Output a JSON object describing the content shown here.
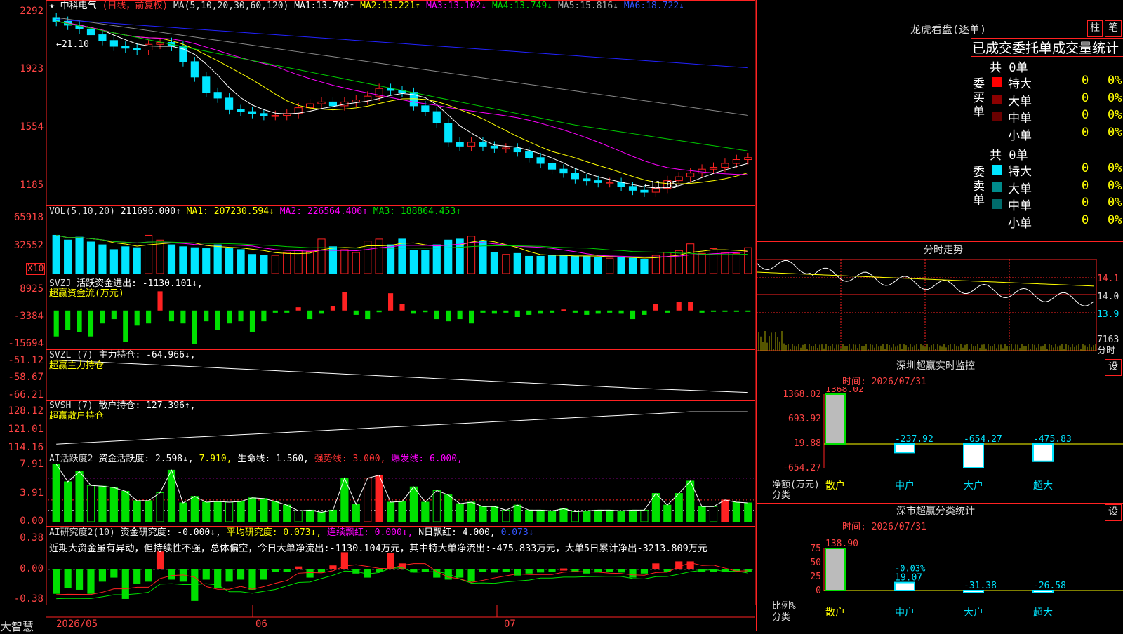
{
  "colors": {
    "up": "#ff2222",
    "down": "#00e5ff",
    "green": "#00e000",
    "grid": "#ff2222",
    "ma1": "#ffffff",
    "ma2": "#ffff00",
    "ma3": "#ff00ff",
    "ma4": "#00cc00",
    "ma5": "#888888",
    "ma6": "#2222ff"
  },
  "header": {
    "star": "★",
    "name": "中科电气",
    "period": "(日线，前复权)",
    "ma_label": "MA(5,10,20,30,60,120)",
    "ma": [
      {
        "label": "MA1:",
        "value": "13.702↑"
      },
      {
        "label": "MA2:",
        "value": "13.221↑"
      },
      {
        "label": "MA3:",
        "value": "13.102↓"
      },
      {
        "label": "MA4:",
        "value": "13.749↓"
      },
      {
        "label": "MA5:",
        "value": "15.816↓"
      },
      {
        "label": "MA6:",
        "value": "18.722↓"
      }
    ]
  },
  "price_axis": [
    "2292",
    "1923",
    "1554",
    "1185"
  ],
  "price_notes": {
    "high": "←21.10",
    "low": "←11.85"
  },
  "vol": {
    "label": "VOL(5,10,20)",
    "value": "211696.000↑",
    "ma1": "MA1: 207230.594↓",
    "ma2": "MA2: 226564.406↑",
    "ma3": "MA3: 188864.453↑",
    "axis": [
      "65918",
      "32552"
    ],
    "unit": "X10"
  },
  "svzj": {
    "label": "SVZJ",
    "name": "活跃资金进出: -1130.101↓,",
    "sub": "超赢资金流(万元)",
    "axis": [
      "8925",
      "-3384",
      "-15694"
    ]
  },
  "svzl": {
    "label": "SVZL (7)",
    "name": "主力持仓: -64.966↓,",
    "sub": "超赢主力持仓",
    "axis": [
      "-51.12",
      "-58.67",
      "-66.21"
    ]
  },
  "svsh": {
    "label": "SVSH (7)",
    "name": "散户持仓: 127.396↑,",
    "sub": "超赢散户持仓",
    "axis": [
      "128.12",
      "121.01",
      "114.16"
    ]
  },
  "ai1": {
    "label": "AI活跃度2",
    "p1": "资金活跃度: 2.598↓,",
    "p2": "7.910,",
    "p3": "生命线: 1.560,",
    "p4": "强势线: 3.000,",
    "p5": "爆发线: 6.000,",
    "axis": [
      "7.91",
      "3.91",
      "0.00"
    ]
  },
  "ai2": {
    "label": "AI研究度2(10)",
    "p1": "资金研究度: -0.000↓,",
    "p2": "平均研究度: 0.073↓,",
    "p3": "连续飘红: 0.000↓,",
    "p4": "N日飘红: 4.000,",
    "p5": "0.073↓",
    "comment": "近期大资金虽有异动，但持续性不强，总体偏空，今日大单净流出:-1130.104万元，其中特大单净流出:-475.833万元，大单5日累计净出-3213.809万元",
    "axis": [
      "0.38",
      "0.00",
      "-0.38"
    ]
  },
  "bottom": {
    "logo": "大智慧",
    "dates": [
      "2026/05",
      "06",
      "07"
    ]
  },
  "right": {
    "title": "龙虎看盘(逐单)",
    "btn1": "柱",
    "btn2": "笔",
    "table_title": "已成交委托单成交量统计",
    "buy": {
      "label": "委买单",
      "total": "共 0单",
      "rows": [
        {
          "name": "特大",
          "count": "0",
          "pct": "0%"
        },
        {
          "name": "大单",
          "count": "0",
          "pct": "0%"
        },
        {
          "name": "中单",
          "count": "0",
          "pct": "0%"
        },
        {
          "name": "小单",
          "count": "0",
          "pct": "0%"
        }
      ]
    },
    "sell": {
      "label": "委卖单",
      "total": "共 0单",
      "rows": [
        {
          "name": "特大",
          "count": "0",
          "pct": "0%"
        },
        {
          "name": "大单",
          "count": "0",
          "pct": "0%"
        },
        {
          "name": "中单",
          "count": "0",
          "pct": "0%"
        },
        {
          "name": "小单",
          "count": "0",
          "pct": "0%"
        }
      ]
    },
    "intraday": {
      "title": "分时走势",
      "axis": [
        "14.1",
        "14.0",
        "13.9"
      ],
      "vol": "7163",
      "vol_unit": "分时"
    },
    "monitor": {
      "title": "深圳超赢实时监控",
      "setbtn": "设",
      "time": "时间: 2026/07/31",
      "axis": [
        "1368.02",
        "693.92",
        "19.88",
        "-654.27"
      ],
      "ylabel": "净额(万元)",
      "xlabel": "分类",
      "bars": [
        {
          "cat": "散户",
          "value": 1368.02,
          "label": "1368.02"
        },
        {
          "cat": "中户",
          "value": -237.92,
          "label": "-237.92"
        },
        {
          "cat": "大户",
          "value": -654.27,
          "label": "-654.27"
        },
        {
          "cat": "超大",
          "value": -475.83,
          "label": "-475.83"
        }
      ]
    },
    "stats": {
      "title": "深市超赢分类统计",
      "setbtn": "设",
      "time": "时间: 2026/07/31",
      "axis": [
        "75",
        "50",
        "25",
        "0"
      ],
      "ylabel": "比例%",
      "xlabel": "分类",
      "bars": [
        {
          "cat": "散户",
          "value": 138.9,
          "label": "138.90"
        },
        {
          "cat": "中户",
          "value": 19.07,
          "label": "19.07",
          "extra": "-0.03%"
        },
        {
          "cat": "大户",
          "value": -31.38,
          "label": "-31.38"
        },
        {
          "cat": "超大",
          "value": -26.58,
          "label": "-26.58"
        }
      ]
    }
  },
  "chart_data": {
    "type": "candlestick",
    "series": [
      {
        "name": "price_close",
        "values": [
          20.9,
          20.7,
          20.5,
          20.2,
          19.9,
          19.6,
          19.5,
          19.4,
          19.7,
          19.8,
          19.6,
          18.8,
          18.0,
          17.2,
          16.9,
          16.3,
          16.2,
          16.1,
          16.0,
          16.0,
          16.1,
          16.4,
          16.6,
          16.7,
          16.5,
          16.7,
          16.8,
          17.0,
          17.4,
          17.3,
          17.2,
          16.5,
          16.2,
          15.6,
          14.6,
          14.4,
          14.6,
          14.4,
          14.3,
          14.3,
          14.1,
          13.8,
          13.5,
          13.2,
          13.0,
          12.7,
          12.6,
          12.5,
          12.5,
          12.3,
          12.1,
          12.0,
          12.2,
          12.6,
          12.8,
          13.0,
          13.2,
          13.3,
          13.5,
          13.7,
          13.8
        ]
      },
      {
        "name": "volume",
        "values": [
          40000,
          35000,
          38000,
          33000,
          30000,
          25000,
          28000,
          27000,
          40000,
          35000,
          30000,
          28000,
          27000,
          26000,
          30000,
          26000,
          25000,
          20000,
          19000,
          19000,
          22000,
          24000,
          23000,
          36000,
          28000,
          25000,
          22000,
          34000,
          36000,
          30000,
          36000,
          24000,
          24000,
          30000,
          35000,
          36000,
          39000,
          34000,
          22000,
          20000,
          21000,
          18000,
          18000,
          19000,
          19000,
          18000,
          18000,
          17000,
          16000,
          17000,
          16000,
          15000,
          19000,
          22000,
          24000,
          31000,
          21000,
          26000,
          22000,
          21000,
          27000
        ]
      },
      {
        "name": "fund_flow",
        "values": [
          -12000,
          -9000,
          -10000,
          -12000,
          -6000,
          -4000,
          -14500,
          -7000,
          -6000,
          8900,
          -5000,
          -6000,
          -15500,
          -5000,
          -9000,
          -6000,
          -5000,
          -10000,
          -5000,
          -1000,
          -1000,
          1500,
          -4000,
          -1500,
          2000,
          8500,
          -2000,
          -4000,
          -800,
          8000,
          3000,
          -1500,
          -800,
          -4000,
          -5000,
          -4000,
          -6000,
          -1000,
          -1500,
          -1000,
          -3000,
          -2000,
          -1500,
          -1000,
          500,
          -1000,
          -2000,
          -1500,
          -1000,
          -1500,
          -4000,
          -2000,
          3000,
          -1000,
          4000,
          4000,
          -1000,
          -500,
          -500,
          -500,
          -500
        ]
      },
      {
        "name": "activity",
        "values": [
          7.91,
          5.5,
          6.9,
          5.0,
          4.9,
          4.7,
          4.2,
          2.9,
          2.9,
          4.0,
          7.1,
          2.6,
          3.5,
          2.7,
          2.8,
          2.7,
          2.8,
          3.3,
          3.2,
          2.8,
          2.3,
          1.5,
          1.6,
          1.3,
          1.6,
          6.0,
          2.4,
          6.0,
          6.4,
          2.7,
          2.8,
          4.8,
          2.7,
          4.3,
          3.7,
          2.5,
          2.7,
          2.1,
          2.1,
          1.6,
          2.3,
          1.6,
          1.6,
          1.5,
          1.8,
          1.4,
          1.5,
          1.6,
          1.6,
          1.5,
          1.6,
          1.6,
          3.9,
          2.3,
          3.9,
          5.6,
          2.1,
          2.1,
          3.0,
          2.7,
          2.6
        ]
      }
    ]
  }
}
